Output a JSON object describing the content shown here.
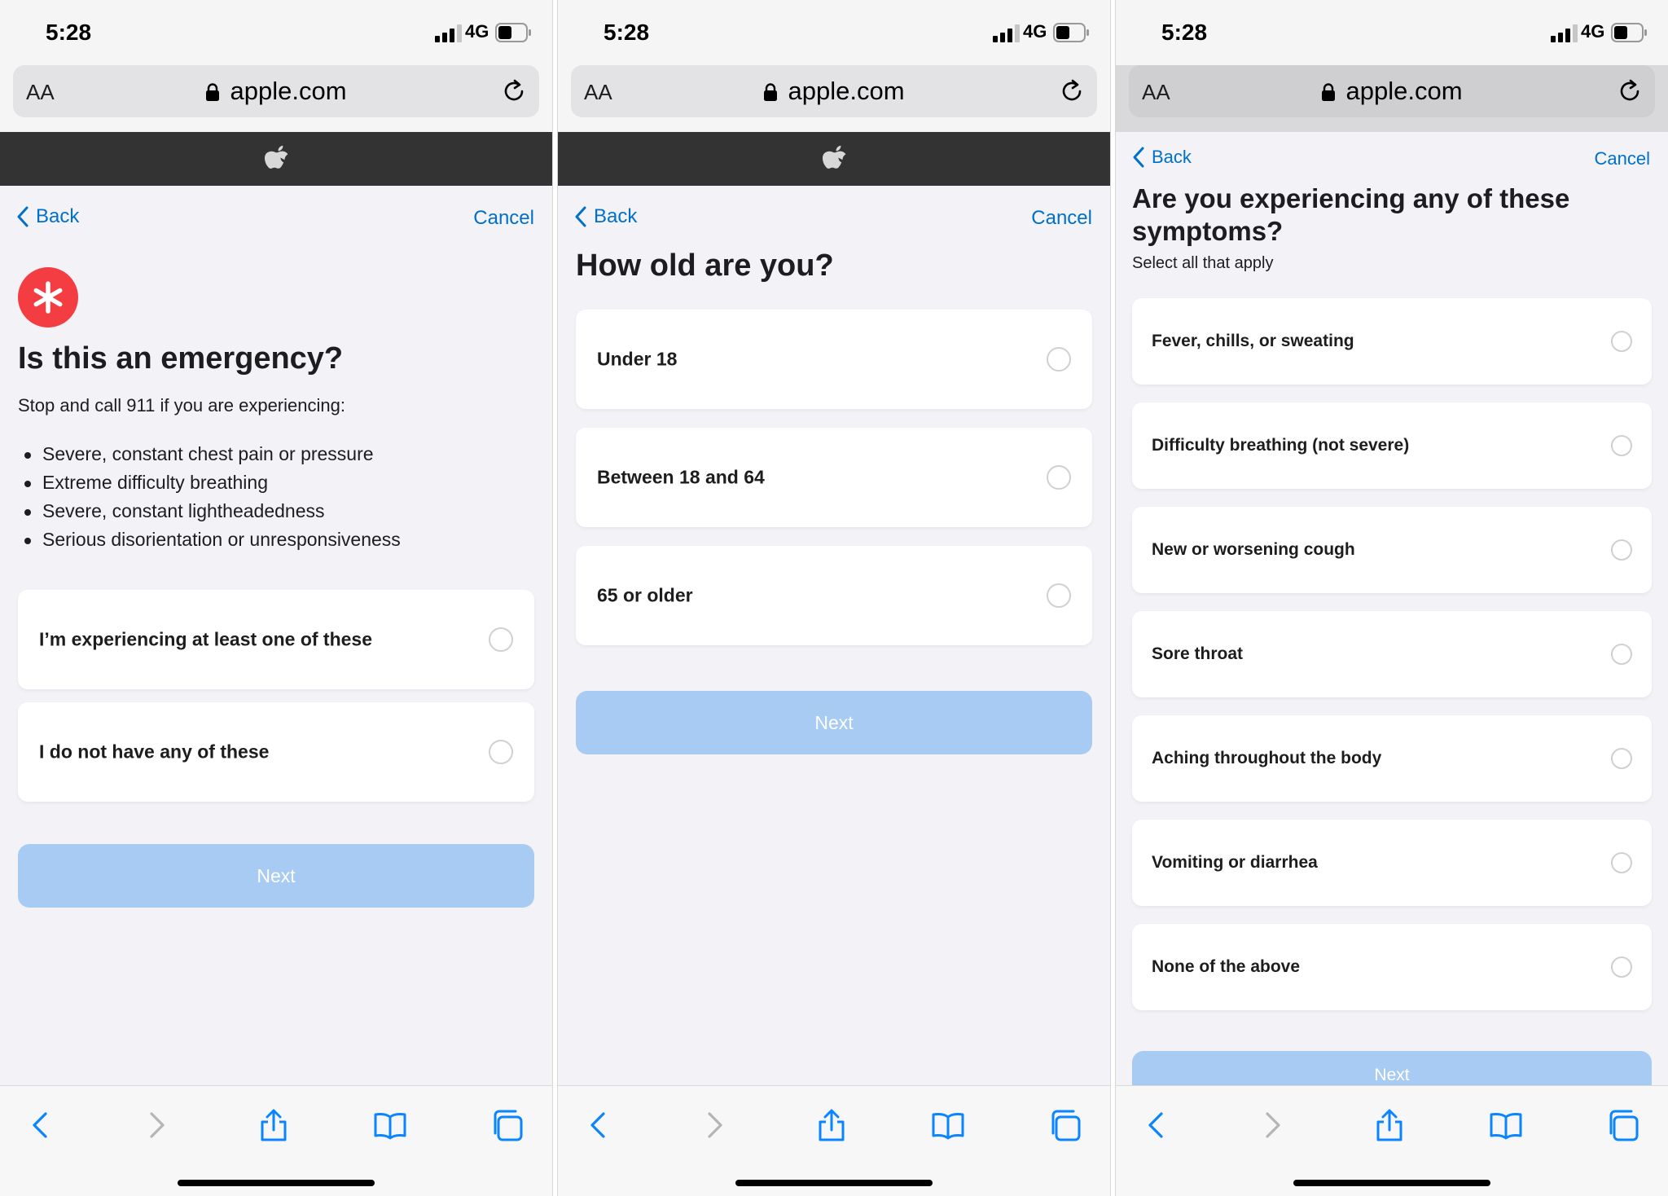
{
  "status": {
    "time": "5:28",
    "network": "4G"
  },
  "browser": {
    "text_size_label": "AA",
    "domain": "apple.com"
  },
  "nav": {
    "back": "Back",
    "cancel": "Cancel"
  },
  "screen1": {
    "title": "Is this an emergency?",
    "subtitle": "Stop and call 911 if you are experiencing:",
    "bullets": [
      "Severe, constant chest pain or pressure",
      "Extreme difficulty breathing",
      "Severe, constant lightheadedness",
      "Serious disorientation or unresponsiveness"
    ],
    "options": [
      "I’m experiencing at least one of these",
      "I do not have any of these"
    ],
    "next": "Next"
  },
  "screen2": {
    "title": "How old are you?",
    "options": [
      "Under 18",
      "Between 18 and 64",
      "65 or older"
    ],
    "next": "Next"
  },
  "screen3": {
    "title": "Are you experiencing any of these symptoms?",
    "subtitle": "Select all that apply",
    "options": [
      "Fever, chills, or sweating",
      "Difficulty breathing (not severe)",
      "New or worsening cough",
      "Sore throat",
      "Aching throughout the body",
      "Vomiting or diarrhea",
      "None of the above"
    ],
    "next": "Next"
  },
  "colors": {
    "accent_blue": "#0070c9",
    "next_disabled": "#a8cbf3",
    "emergency_red": "#f33d42",
    "apple_bar": "#333333"
  },
  "icons": {
    "status": [
      "signal-icon",
      "battery-icon"
    ],
    "browser": [
      "lock-icon",
      "reload-icon"
    ],
    "header": "apple-logo-icon",
    "emergency": "asterisk-icon",
    "toolbar": [
      "back-arrow-icon",
      "forward-arrow-icon",
      "share-icon",
      "bookmarks-icon",
      "tabs-icon"
    ]
  }
}
